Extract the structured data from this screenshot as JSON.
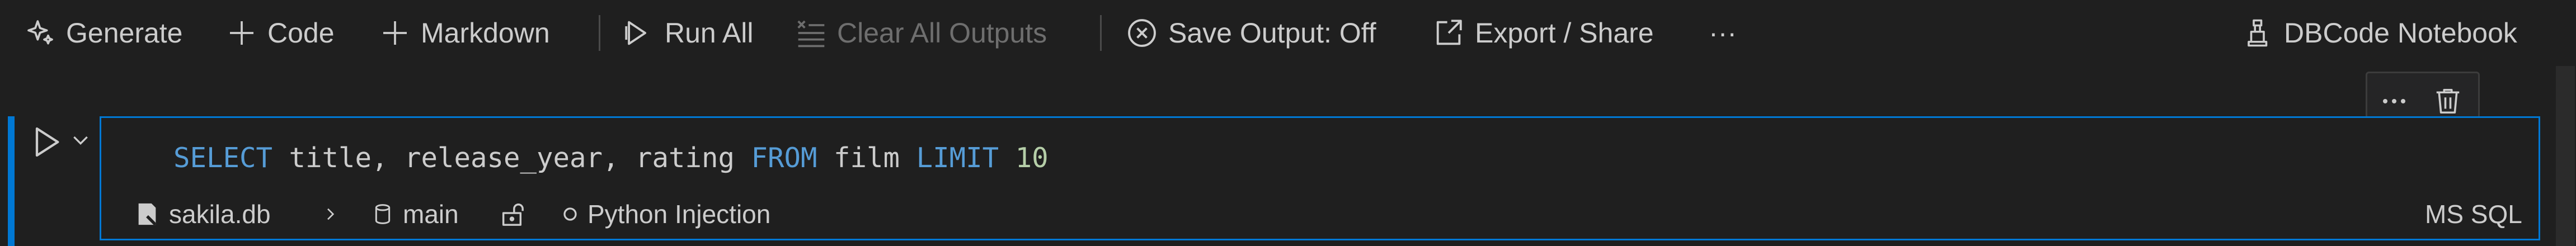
{
  "toolbar": {
    "generate_label": "Generate",
    "code_label": "Code",
    "markdown_label": "Markdown",
    "run_all_label": "Run All",
    "clear_outputs_label": "Clear All Outputs",
    "save_output_label": "Save Output: Off",
    "export_label": "Export / Share",
    "more_label": "···",
    "kernel_label": "DBCode Notebook"
  },
  "cell": {
    "code": {
      "kw_select": "SELECT",
      "cols": " title, release_year, rating ",
      "kw_from": "FROM",
      "table": " film ",
      "kw_limit": "LIMIT",
      "space": " ",
      "limit_value": "10"
    },
    "status": {
      "database": "sakila.db",
      "schema": "main",
      "injection": "Python Injection",
      "dialect": "MS SQL"
    }
  },
  "colors": {
    "accent": "#0078d4",
    "keyword": "#569cd6",
    "number": "#b5cea8",
    "background": "#1f1f1f",
    "text": "#cccccc",
    "disabled": "#6e6e6e"
  }
}
